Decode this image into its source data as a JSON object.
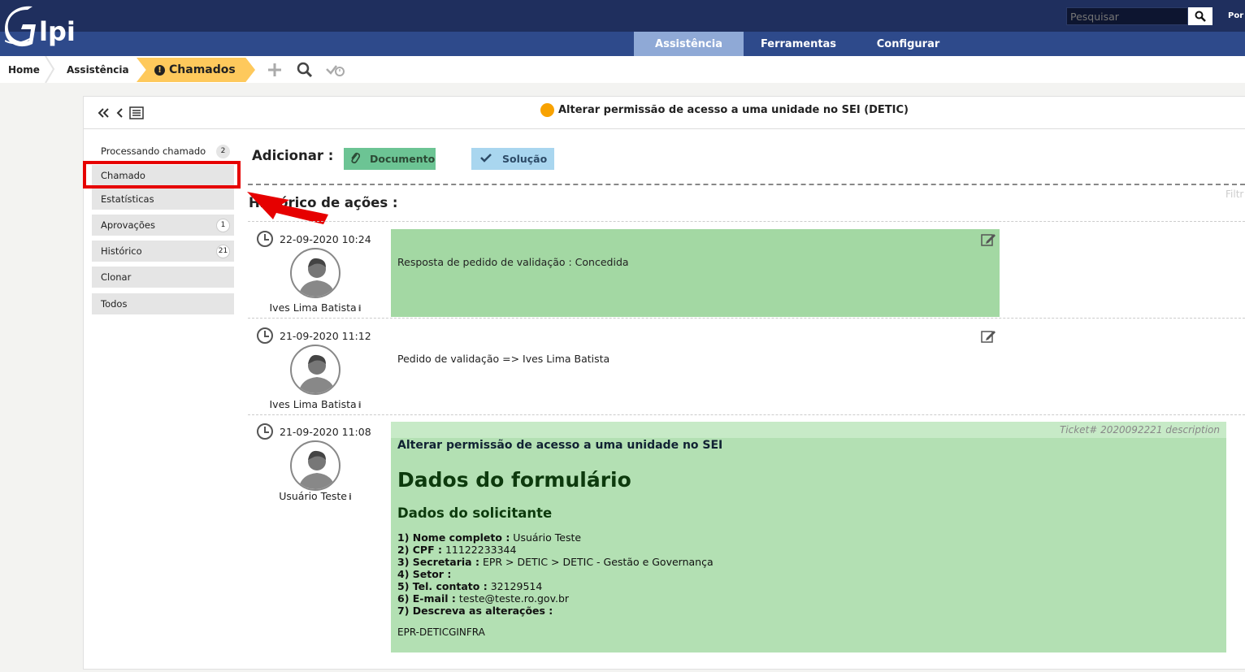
{
  "header": {
    "logo_text": "Glpi",
    "search_placeholder": "Pesquisar",
    "lang_label": "Por",
    "nav": [
      {
        "label": "Assistência",
        "active": true
      },
      {
        "label": "Ferramentas",
        "active": false
      },
      {
        "label": "Configurar",
        "active": false
      }
    ]
  },
  "breadcrumb": {
    "home": "Home",
    "assist": "Assistência",
    "current": "Chamados",
    "current_icon": "!",
    "icons": [
      "plus-icon",
      "search-icon",
      "check-clock-icon"
    ]
  },
  "ticket": {
    "title": "Alterar permissão de acesso a uma unidade no SEI (DETIC)",
    "status_color": "#f8a200"
  },
  "menu": [
    {
      "label": "Processando chamado",
      "count": "2"
    },
    {
      "label": "Chamado",
      "count": ""
    },
    {
      "label": "Estatísticas",
      "count": ""
    },
    {
      "label": "Aprovações",
      "count": "1"
    },
    {
      "label": "Histórico",
      "count": "21"
    },
    {
      "label": "Clonar",
      "count": ""
    },
    {
      "label": "Todos",
      "count": ""
    }
  ],
  "actions": {
    "add_label": "Adicionar :",
    "document": "Documento",
    "solution": "Solução",
    "filter": "Filtr"
  },
  "history": {
    "title": "Histórico de ações :",
    "entries": [
      {
        "time": "22-09-2020 10:24",
        "author": "Ives Lima Batista",
        "text": "Resposta de pedido de validação : Concedida"
      },
      {
        "time": "21-09-2020 11:12",
        "author": "Ives Lima Batista",
        "text": "Pedido de validação => Ives Lima Batista"
      },
      {
        "time": "21-09-2020 11:08",
        "author": "Usuário Teste",
        "text": ""
      }
    ]
  },
  "description": {
    "label": "Ticket# 2020092221 description",
    "title": "Alterar permissão de acesso a uma unidade no SEI",
    "h1": "Dados do formulário",
    "h2": "Dados do solicitante",
    "fields": [
      {
        "label": "1) Nome completo :",
        "value": "Usuário Teste"
      },
      {
        "label": "2) CPF :",
        "value": "11122233344"
      },
      {
        "label": "3) Secretaria :",
        "value": "EPR > DETIC > DETIC - Gestão e Governança"
      },
      {
        "label": "4) Setor :",
        "value": ""
      },
      {
        "label": "5) Tel. contato :",
        "value": "32129514"
      },
      {
        "label": "6) E-mail :",
        "value": "teste@teste.ro.gov.br"
      },
      {
        "label": "7) Descreva as alterações :",
        "value": ""
      }
    ],
    "footer": "EPR-DETICGINFRA"
  },
  "colors": {
    "header_dark": "#1f2f5e",
    "header_nav": "#2e4a8b",
    "nav_active": "#8fa9d6",
    "breadcrumb_active": "#fec95c",
    "validation_green": "#a3d8a3",
    "description_green": "#b3e0b3",
    "highlight_red": "#e60000"
  }
}
